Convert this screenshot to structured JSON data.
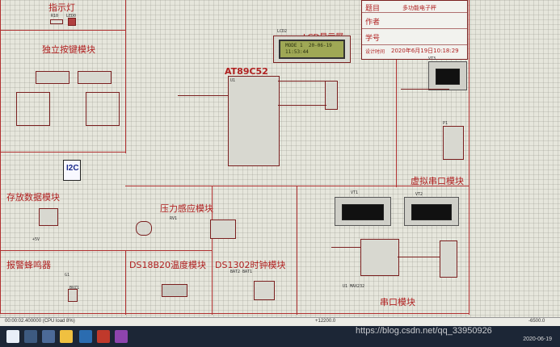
{
  "modules": {
    "indicator": "指示灯",
    "keys": "独立按键模块",
    "lcd": "LCD显示屏",
    "mcu": "AT89C52",
    "storage": "存放数据模块",
    "pressure": "压力感应模块",
    "buzzer": "报警蜂鸣器",
    "ds18b20": "DS18B20温度模块",
    "ds1302": "DS1302时钟模块",
    "virtual_serial": "虚拟串口模块",
    "serial": "串口模块"
  },
  "info_block": {
    "title_label": "题目",
    "title_value": "多功能电子秤",
    "author_label": "作者",
    "student_id_label": "学号",
    "design_time_label": "设计时间",
    "design_time_value": "2020年6月19日10:18:29"
  },
  "lcd_screen": {
    "line1": "MODE 1  20-06-19",
    "line2": "11:53:44"
  },
  "components": {
    "lcd_ref": "LCD2",
    "i2c_badge": "I2C",
    "vt1": "VT1",
    "vt2": "VT2",
    "vt3": "VT3",
    "max232": "U1 MAX232",
    "u1": "U1",
    "p1": "P1",
    "rv1": "RV1",
    "g1": "G1",
    "buz1": "BUZ1",
    "bat1": "BAT1",
    "bat2": "BAT2",
    "r10": "R10",
    "led_ref": "LED0",
    "plus5v": "+5V"
  },
  "status_bar": {
    "sim_time": "00:00:02.400000 (CPU load 8%)",
    "coord_x": "+12200.0",
    "coord_y": "-6500.0"
  },
  "taskbar": {
    "watermark": "https://blog.csdn.net/qq_33950926",
    "date": "2020-06-19"
  }
}
